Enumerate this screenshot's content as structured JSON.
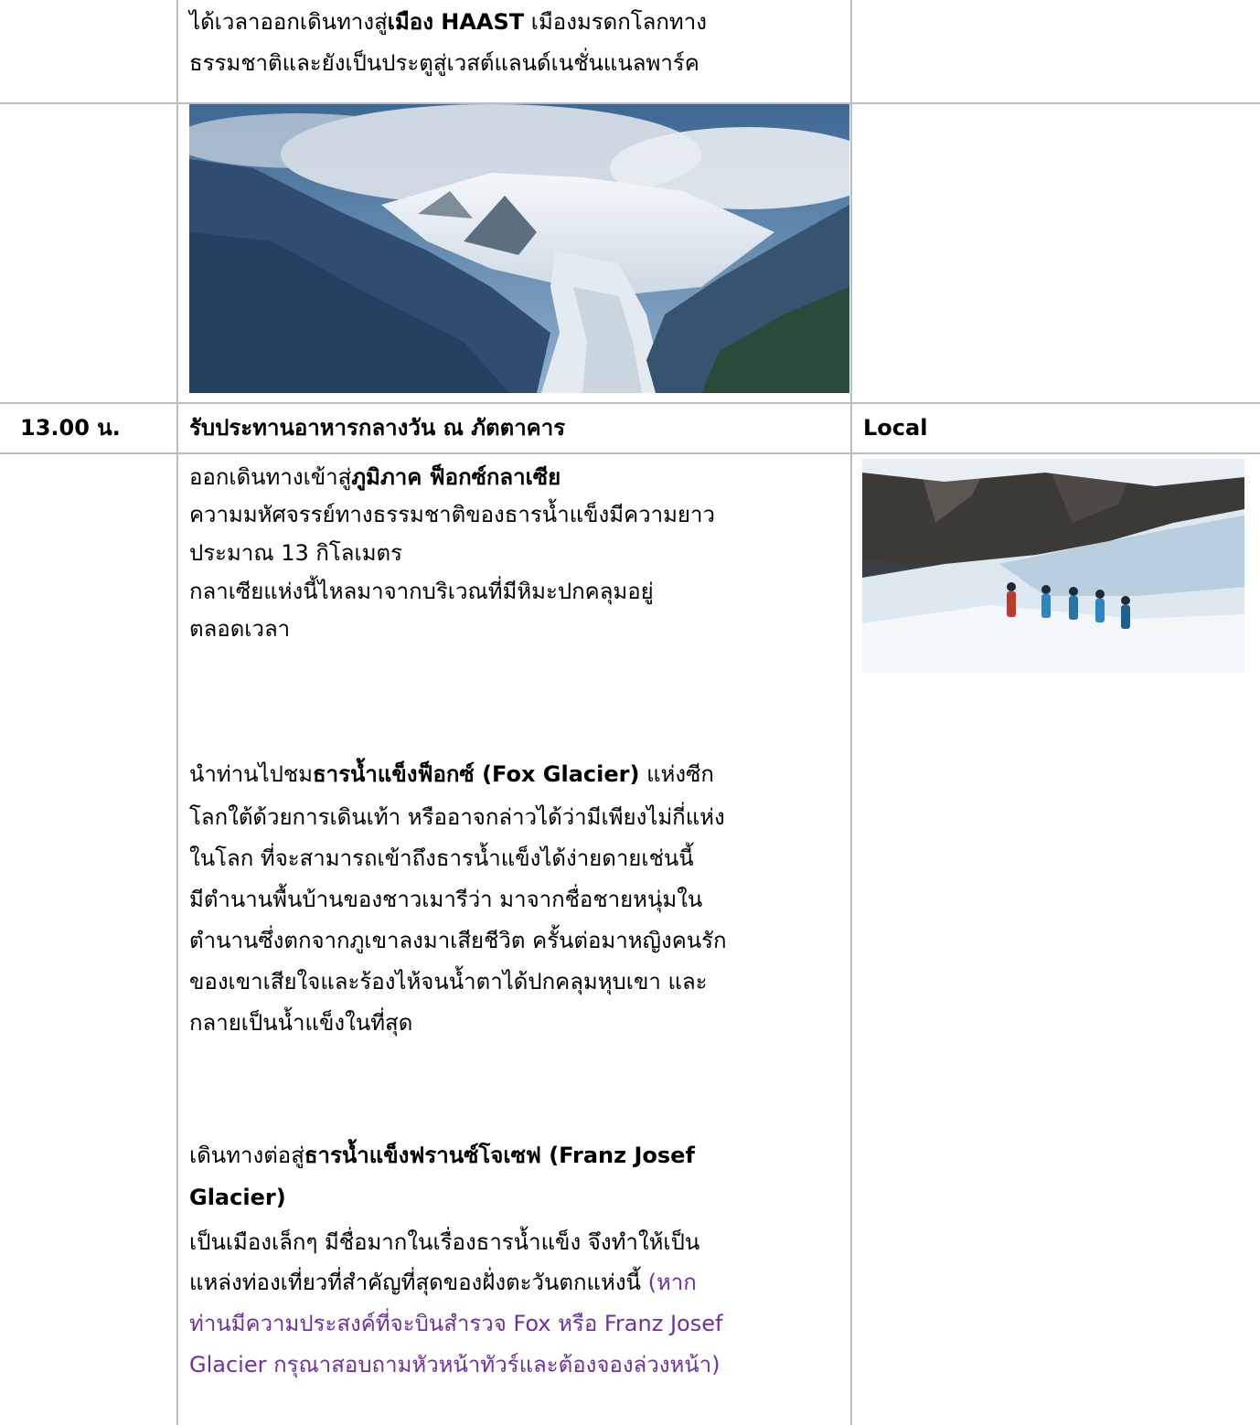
{
  "row1": {
    "line1_a": "ได้เวลาออกเดินทางสู่",
    "line1_b": "เมือง HAAST",
    "line1_c": " เมืองมรดกโลกทาง",
    "line2": "ธรรมชาติและยังเป็นประตูสู่เวสต์แลนด์เนชั่นแนลพาร์ค"
  },
  "row3": {
    "time": "13.00 น.",
    "activity": "รับประทานอาหารกลางวัน ณ ภัตตาคาร",
    "meal": "Local"
  },
  "row4": {
    "p1_a": "ออกเดินทางเข้าสู่",
    "p1_b": "ภูมิภาค ฟ็อกซ์กลาเซีย",
    "p1_l2": "ความมหัศจรรย์ทางธรรมชาติของธารน้ำแข็งมีความยาว",
    "p1_l3": "ประมาณ 13 กิโลเมตร",
    "p1_l4": "กลาเซียแห่งนี้ไหลมาจากบริเวณที่มีหิมะปกคลุมอยู่",
    "p1_l5": "ตลอดเวลา",
    "p2_a": "นำท่านไปชม",
    "p2_b": "ธารน้ำแข็งฟ็อกซ์ (Fox Glacier)",
    "p2_c": " แห่งซีก",
    "p2_l2": "โลกใต้ด้วยการเดินเท้า หรืออาจกล่าวได้ว่ามีเพียงไม่กี่แห่ง",
    "p2_l3": "ในโลก ที่จะสามารถเข้าถึงธารน้ำแข็งได้ง่ายดายเช่นนี้",
    "p2_l4": "มีตำนานพื้นบ้านของชาวเมารีว่า มาจากชื่อชายหนุ่มใน",
    "p2_l5": "ตำนานซึ่งตกจากภูเขาลงมาเสียชีวิต ครั้นต่อมาหญิงคนรัก",
    "p2_l6": "ของเขาเสียใจและร้องไห้จนน้ำตาได้ปกคลุมหุบเขา และ",
    "p2_l7": "กลายเป็นน้ำแข็งในที่สุด",
    "p3_a": "เดินทางต่อสู่",
    "p3_b": "ธารน้ำแข็งฟรานซ์โจเซฟ (Franz Josef",
    "p3_l2": "Glacier)",
    "p3_l3": "เป็นเมืองเล็กๆ มีชื่อมากในเรื่องธารน้ำแข็ง จึงทำให้เป็น",
    "p3_l4a": "แหล่งท่องเที่ยวที่สำคัญที่สุดของฝั่งตะวันตกแห่งนี้ ",
    "p3_l4b": "(หาก",
    "p3_l5": "ท่านมีความประสงค์ที่จะบินสำรวจ Fox หรือ Franz Josef",
    "p3_l6": "Glacier กรุณาสอบถามหัวหน้าทัวร์และต้องจองล่วงหน้า)"
  },
  "colors": {
    "border": "#bdbdbd",
    "note": "#7030a0"
  }
}
